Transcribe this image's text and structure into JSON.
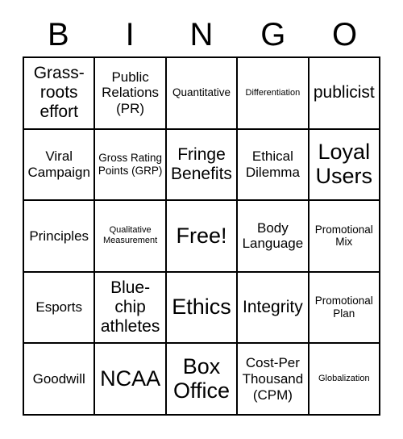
{
  "card": {
    "title": "BINGO",
    "header_letters": [
      "B",
      "I",
      "N",
      "G",
      "O"
    ],
    "free_space": "Free!",
    "border_color": "#000000",
    "background_color": "#ffffff",
    "text_color": "#000000",
    "rows": 5,
    "columns": 5
  },
  "cells": [
    {
      "text": "Grass-roots effort",
      "size": "lg"
    },
    {
      "text": "Public Relations (PR)",
      "size": "md"
    },
    {
      "text": "Quantitative",
      "size": "sm"
    },
    {
      "text": "Differentiation",
      "size": "xs"
    },
    {
      "text": "publicist",
      "size": "lg"
    },
    {
      "text": "Viral Campaign",
      "size": "md"
    },
    {
      "text": "Gross Rating Points (GRP)",
      "size": "sm"
    },
    {
      "text": "Fringe Benefits",
      "size": "lg"
    },
    {
      "text": "Ethical Dilemma",
      "size": "md"
    },
    {
      "text": "Loyal Users",
      "size": "xl"
    },
    {
      "text": "Principles",
      "size": "md"
    },
    {
      "text": "Qualitative Measurement",
      "size": "xs"
    },
    {
      "text": "Free!",
      "size": "xl"
    },
    {
      "text": "Body Language",
      "size": "md"
    },
    {
      "text": "Promotional Mix",
      "size": "sm"
    },
    {
      "text": "Esports",
      "size": "md"
    },
    {
      "text": "Blue-chip athletes",
      "size": "lg"
    },
    {
      "text": "Ethics",
      "size": "xl"
    },
    {
      "text": "Integrity",
      "size": "lg"
    },
    {
      "text": "Promotional Plan",
      "size": "sm"
    },
    {
      "text": "Goodwill",
      "size": "md"
    },
    {
      "text": "NCAA",
      "size": "xl"
    },
    {
      "text": "Box Office",
      "size": "xl"
    },
    {
      "text": "Cost-Per Thousand (CPM)",
      "size": "md"
    },
    {
      "text": "Globalization",
      "size": "xs"
    }
  ]
}
